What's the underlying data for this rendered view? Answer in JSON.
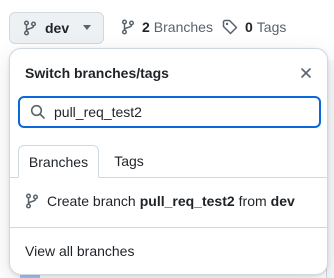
{
  "topbar": {
    "branch_name": "dev",
    "branches_count": "2",
    "branches_label": "Branches",
    "tags_count": "0",
    "tags_label": "Tags"
  },
  "panel": {
    "title": "Switch branches/tags",
    "search_value": "pull_req_test2",
    "tabs": [
      {
        "label": "Branches",
        "active": true
      },
      {
        "label": "Tags",
        "active": false
      }
    ],
    "create": {
      "prefix": "Create branch",
      "name": "pull_req_test2",
      "from": "from",
      "source": "dev"
    },
    "view_all": "View all branches"
  },
  "colors": {
    "accent": "#0969da",
    "border": "#d1d9e0",
    "muted": "#59636e",
    "text": "#1f2328"
  }
}
